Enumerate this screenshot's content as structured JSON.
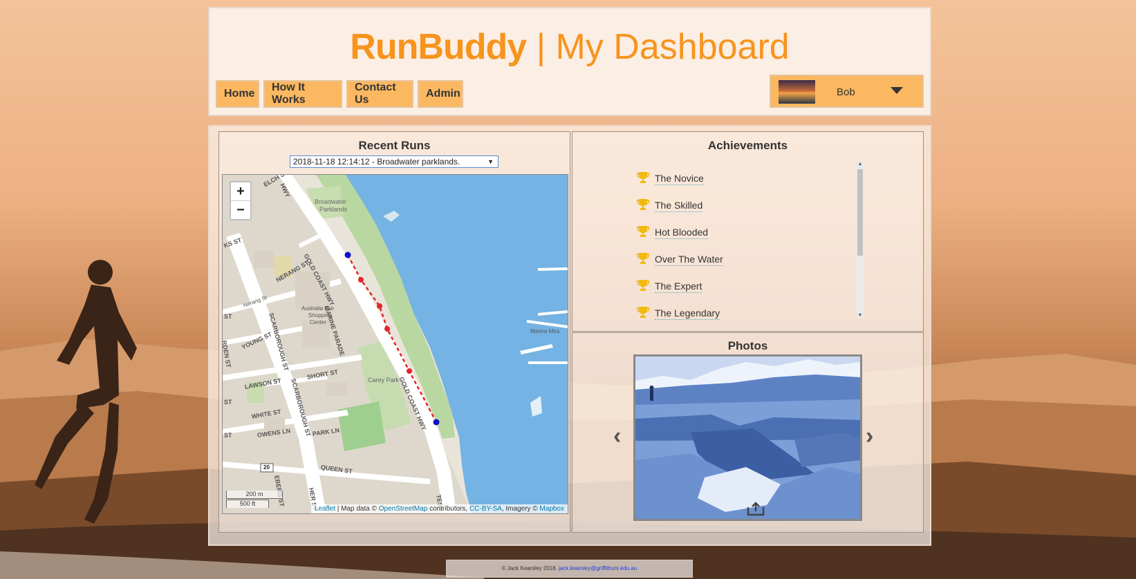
{
  "header": {
    "brand": "RunBuddy",
    "separator": " | ",
    "subtitle": "My Dashboard"
  },
  "nav": {
    "items": [
      {
        "label": "Home"
      },
      {
        "label": "How It Works"
      },
      {
        "label": "Contact Us"
      },
      {
        "label": "Admin"
      }
    ]
  },
  "user": {
    "name": "Bob",
    "menu_icon": "chevron-down-icon"
  },
  "recent_runs": {
    "title": "Recent Runs",
    "selected_run": "2018-11-18 12:14:12 - Broadwater parklands.",
    "map": {
      "zoom_in": "+",
      "zoom_out": "−",
      "scale_metric": "200 m",
      "scale_imperial": "500 ft",
      "attribution": {
        "leaflet": "Leaflet",
        "map_data": " | Map data © ",
        "osm": "OpenStreetMap",
        "contributors": " contributors, ",
        "license": "CC-BY-SA",
        "imagery": ", Imagery © ",
        "mapbox": "Mapbox"
      },
      "labels": {
        "broadwater": "Broadwater",
        "parklands": "Parklands",
        "gold_coast_hwy_1": "GOLD COAST HWY",
        "gold_coast_hwy_2": "GOLD COAST HWY",
        "marine_parade": "MARINE PARADE",
        "nerang_st": "NERANG ST",
        "nerang_st_small": "Nerang St",
        "australia_fair_1": "Australia Fair",
        "australia_fair_2": "Shopping",
        "australia_fair_3": "Center",
        "scarborough_st_1": "SCARBOROUGH ST",
        "scarborough_st_2": "SCARBOROUGH ST",
        "young_st": "YOUNG ST",
        "lawson_st": "LAWSON ST",
        "short_st": "SHORT ST",
        "white_st": "WHITE ST",
        "owens_ln": "OWENS LN",
        "park_ln": "PARK LN",
        "queen_st": "QUEEN ST",
        "carey_park": "Carey Park",
        "marina_mirage": "Marina Mira",
        "route_20": "20",
        "welch_st": "ELCH ST",
        "hwy_top": "HWY",
        "ks_st": "KS ST",
        "st_left": "ST",
        "arden_st": "RDEN ST",
        "st_left2": "ST",
        "st_left3": "ST",
        "eberg": "EBERG ST",
        "her_st": "HER ST",
        "tess": "TESS"
      }
    }
  },
  "achievements": {
    "title": "Achievements",
    "items": [
      {
        "label": "The Novice",
        "icon": "trophy-icon"
      },
      {
        "label": "The Skilled",
        "icon": "trophy-icon"
      },
      {
        "label": "Hot Blooded",
        "icon": "trophy-icon"
      },
      {
        "label": "Over The Water",
        "icon": "trophy-icon"
      },
      {
        "label": "The Expert",
        "icon": "trophy-icon"
      },
      {
        "label": "The Legendary",
        "icon": "trophy-icon"
      }
    ]
  },
  "photos": {
    "title": "Photos",
    "prev": "‹",
    "next": "›",
    "share_icon": "share-icon"
  },
  "footer": {
    "copyright": "© Jack Kearsley 2018. ",
    "email": "jack.kearsley@griffithuni.edu.au"
  },
  "colors": {
    "accent": "#f7941d",
    "button_bg": "#fbb861",
    "water": "#74b3e3",
    "route": "#e0262a",
    "marker": "#1010c8"
  }
}
